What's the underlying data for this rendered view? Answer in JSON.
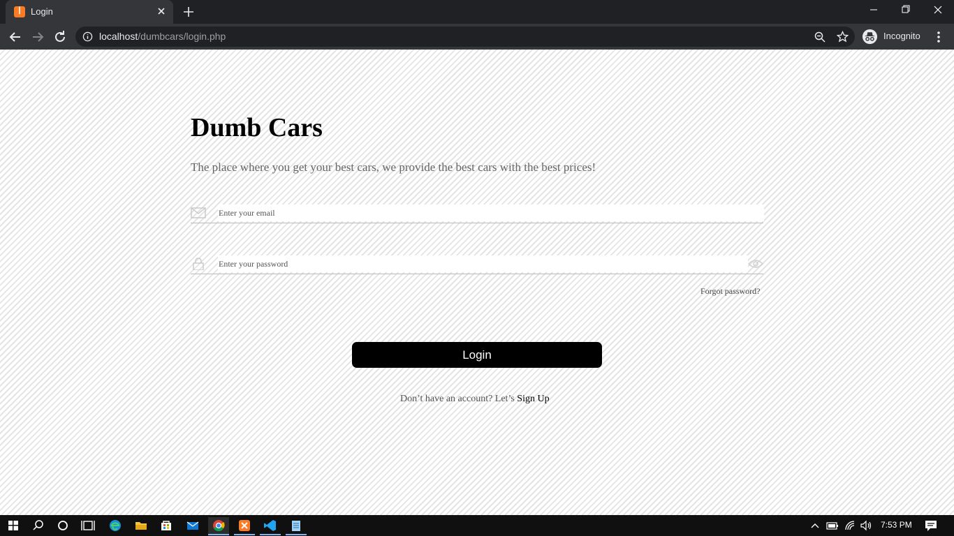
{
  "browser": {
    "tab_title": "Login",
    "url_host": "localhost",
    "url_path": "/dumbcars/login.php",
    "incognito_label": "Incognito"
  },
  "page": {
    "title": "Dumb Cars",
    "subtitle": "The place where you get your best cars, we provide the best cars with the best prices!",
    "email_placeholder": "Enter your email",
    "password_placeholder": "Enter your password",
    "forgot_label": "Forgot password?",
    "login_label": "Login",
    "signup_prompt": "Don’t have an account? Let’s ",
    "signup_link": "Sign Up"
  },
  "taskbar": {
    "time": "7:53 PM"
  },
  "colors": {
    "accent": "#000000",
    "browser_dark": "#202124",
    "toolbar": "#35363a",
    "xampp_orange": "#fb7a24"
  }
}
